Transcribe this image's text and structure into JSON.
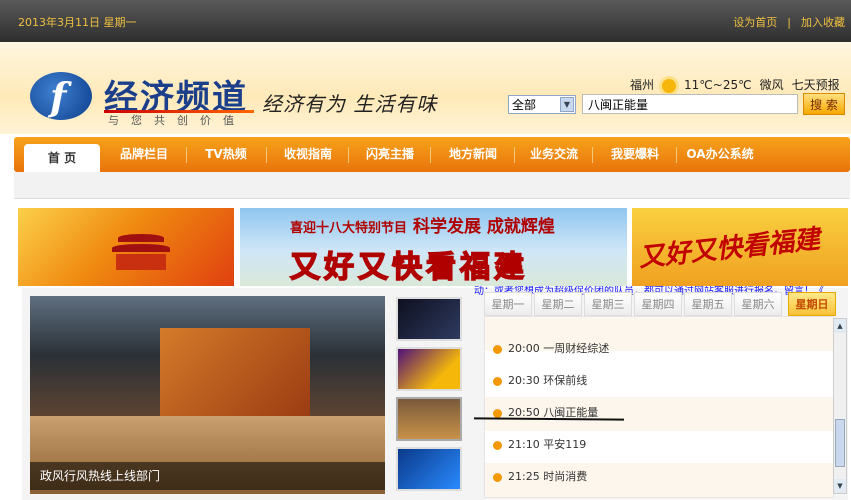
{
  "topbar": {
    "date": "2013年3月11日 星期一",
    "set_home": "设为首页",
    "separator": "|",
    "add_favorite": "加入收藏"
  },
  "header": {
    "logo_name": "经济频道",
    "logo_sub": "与您共创价值",
    "slogan": "经济有为  生活有味"
  },
  "weather": {
    "city": "福州",
    "icon": "sun-icon",
    "temp": "11℃~25℃",
    "wind": "微风",
    "forecast_link": "七天预报"
  },
  "search": {
    "scope_selected": "全部",
    "query": "八闽正能量",
    "button_label": "搜 索"
  },
  "nav": {
    "tabs": [
      {
        "label": "首 页",
        "active": true
      },
      {
        "label": "品牌栏目",
        "active": false
      },
      {
        "label": "TV热频",
        "active": false
      },
      {
        "label": "收视指南",
        "active": false
      },
      {
        "label": "闪亮主播",
        "active": false
      },
      {
        "label": "地方新闻",
        "active": false
      },
      {
        "label": "业务交流",
        "active": false
      },
      {
        "label": "我要爆料",
        "active": false
      },
      {
        "label": "OA办公系统",
        "active": false
      }
    ]
  },
  "banners": {
    "middle_top": "喜迎十八大特别节目",
    "middle_top_big": "科学发展 成就辉煌",
    "middle_main": "又好又快看福建",
    "right_main": "又好又快看福建"
  },
  "video": {
    "caption": "政风行风热线上线部门"
  },
  "marquee": {
    "text": "动；或者您想成为超级促价团的队员，都可以通过网站客服进行报名。留言！《"
  },
  "schedule": {
    "days": [
      {
        "label": "星期一",
        "active": false
      },
      {
        "label": "星期二",
        "active": false
      },
      {
        "label": "星期三",
        "active": false
      },
      {
        "label": "星期四",
        "active": false
      },
      {
        "label": "星期五",
        "active": false
      },
      {
        "label": "星期六",
        "active": false
      },
      {
        "label": "星期日",
        "active": true
      }
    ],
    "programs": [
      {
        "time": "20:00",
        "title": "一周财经综述"
      },
      {
        "time": "20:30",
        "title": "环保前线"
      },
      {
        "time": "20:50",
        "title": "八闽正能量"
      },
      {
        "time": "21:10",
        "title": "平安119"
      },
      {
        "time": "21:25",
        "title": "时尚消费"
      }
    ]
  },
  "colors": {
    "nav_orange": "#e8740a",
    "topbar_text": "#f0c040",
    "brand_blue": "#1b3f8b"
  }
}
